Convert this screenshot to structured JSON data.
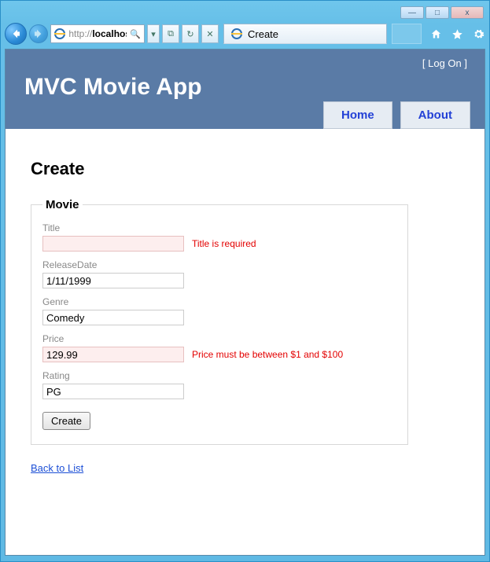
{
  "window": {
    "minimize": "—",
    "maximize": "□",
    "close": "x"
  },
  "toolbar": {
    "url_proto": "http://",
    "url_host": "localhost",
    "search_icon": "🔍",
    "dropdown": "▾",
    "btn_split": "⧉",
    "btn_refresh": "↻",
    "btn_stop": "✕",
    "tab_title": "Create"
  },
  "cmdbar": {
    "home": "home-icon",
    "fav": "star-icon",
    "gear": "gear-icon"
  },
  "site": {
    "logon_open": "[ ",
    "logon_link": "Log On",
    "logon_close": " ]",
    "title": "MVC Movie App",
    "nav_home": "Home",
    "nav_about": "About"
  },
  "page": {
    "heading": "Create",
    "legend": "Movie",
    "labels": {
      "title": "Title",
      "release": "ReleaseDate",
      "genre": "Genre",
      "price": "Price",
      "rating": "Rating"
    },
    "values": {
      "title": "",
      "release": "1/11/1999",
      "genre": "Comedy",
      "price": "129.99",
      "rating": "PG"
    },
    "errors": {
      "title": "Title is required",
      "price": "Price must be between $1 and $100"
    },
    "submit": "Create",
    "back": "Back to List"
  }
}
